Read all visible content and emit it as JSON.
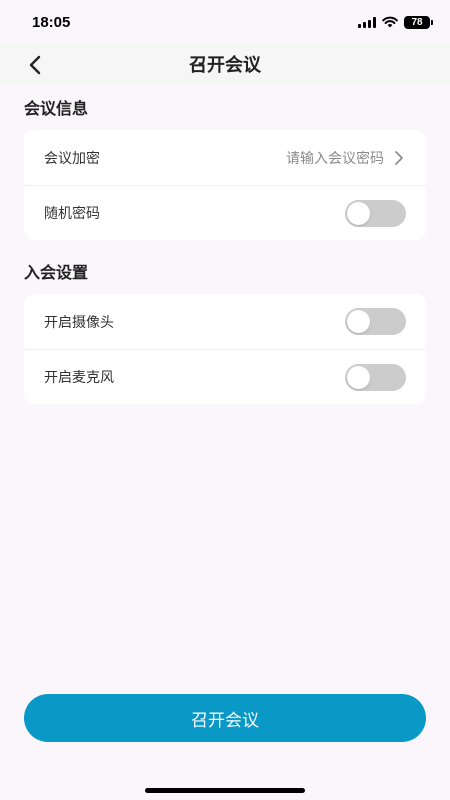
{
  "status": {
    "time": "18:05",
    "battery": "78"
  },
  "header": {
    "title": "召开会议"
  },
  "sections": [
    {
      "title": "会议信息",
      "rows": [
        {
          "label": "会议加密",
          "value": "请输入会议密码"
        },
        {
          "label": "随机密码",
          "toggle_on": false
        }
      ]
    },
    {
      "title": "入会设置",
      "rows": [
        {
          "label": "开启摄像头",
          "toggle_on": false
        },
        {
          "label": "开启麦克风",
          "toggle_on": false
        }
      ]
    }
  ],
  "footer": {
    "button_label": "召开会议"
  },
  "colors": {
    "accent": "#0A98C6",
    "background": "#FBF5FC",
    "toggle_off": "#CCCCCC"
  },
  "icons": [
    "back-arrow",
    "chevron-right",
    "signal",
    "wifi",
    "battery"
  ]
}
